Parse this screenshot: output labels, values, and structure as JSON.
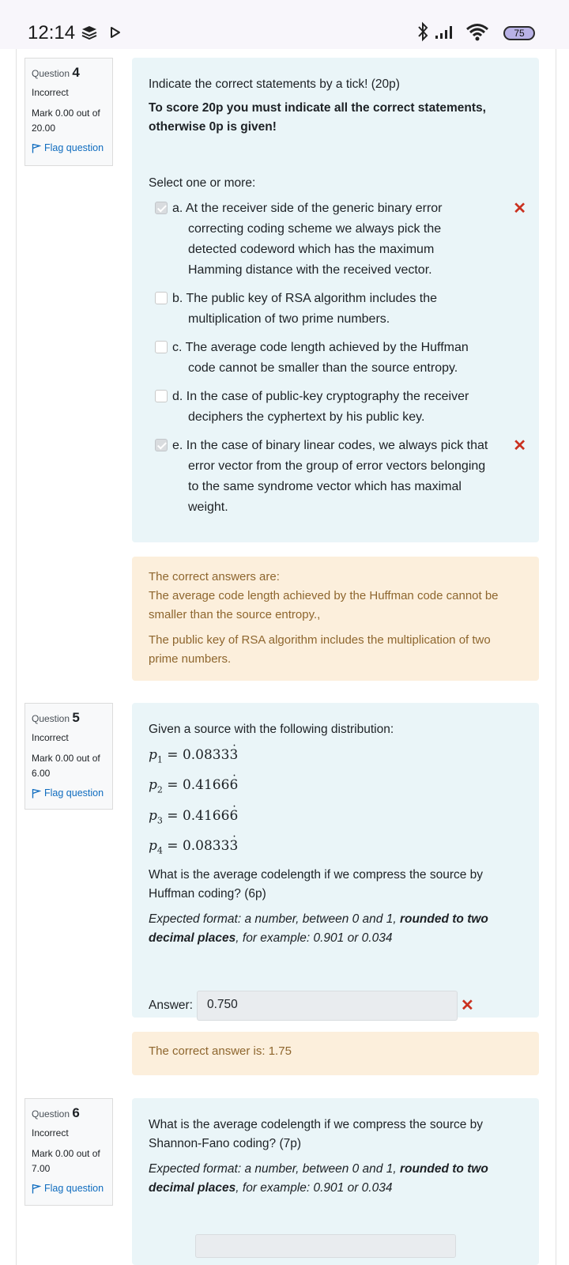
{
  "status_bar": {
    "time": "12:14",
    "battery": "75",
    "icons": [
      "layers-icon",
      "play-icon",
      "bluetooth-icon",
      "signal-icon",
      "wifi-icon",
      "battery-icon"
    ]
  },
  "colors": {
    "question_bg": "#eaf5f8",
    "feedback_bg": "#fcefdc",
    "feedback_text": "#8e662e",
    "link": "#0f6cbf",
    "incorrect": "#ca3120"
  },
  "questions": [
    {
      "info": {
        "label": "Question",
        "number": "4",
        "state": "Incorrect",
        "mark": "Mark 0.00 out of 20.00",
        "flag": "Flag question"
      },
      "text": "Indicate the correct statements by a tick! (20p)",
      "bold_text": "To score 20p you must indicate all the correct statements, otherwise 0p is given!",
      "prompt": "Select one or more:",
      "options": [
        {
          "text": "a. At the receiver side of the generic binary error correcting coding scheme we always pick the detected codeword which has the maximum Hamming distance with the received vector.",
          "checked": true,
          "incorrect": true
        },
        {
          "text": "b. The public key of RSA algorithm includes the multiplication of two prime numbers.",
          "checked": false,
          "incorrect": false
        },
        {
          "text": "c. The average code length achieved by the Huffman code cannot be smaller than the source entropy.",
          "checked": false,
          "incorrect": false
        },
        {
          "text": "d. In the case of public-key cryptography the receiver deciphers the cyphertext by his public key.",
          "checked": false,
          "incorrect": false
        },
        {
          "text": "e. In the case of binary linear codes, we always pick that error vector from the group of error vectors belonging to the same syndrome vector which has maximal weight.",
          "checked": true,
          "incorrect": true
        }
      ],
      "feedback": {
        "heading": "The correct answers are:",
        "answer1": "The average code length achieved by the Huffman code cannot be smaller than the source entropy.,",
        "answer2": "The public key of RSA algorithm includes the multiplication of two prime numbers."
      },
      "incorrect_mark": "✕"
    },
    {
      "info": {
        "label": "Question",
        "number": "5",
        "state": "Incorrect",
        "mark": "Mark 0.00 out of 6.00",
        "flag": "Flag question"
      },
      "text": "Given a source with the following distribution:",
      "distribution": [
        {
          "symbol": "p",
          "sub": "1",
          "value": "= 0.0833",
          "dot": "3"
        },
        {
          "symbol": "p",
          "sub": "2",
          "value": "= 0.4166",
          "dot": "6"
        },
        {
          "symbol": "p",
          "sub": "3",
          "value": "= 0.4166",
          "dot": "6"
        },
        {
          "symbol": "p",
          "sub": "4",
          "value": "= 0.0833",
          "dot": "3"
        }
      ],
      "question": "What is the average codelength if we compress the source by Huffman coding? (6p)",
      "format_intro": "Expected format: a number, between 0 and 1, ",
      "format_bold": "rounded to two decimal places",
      "format_outro": ", for example: 0.901 or 0.034",
      "answer_label": "Answer:",
      "answer_value": "0.750",
      "feedback": "The correct answer is: 1.75",
      "incorrect_mark": "✕"
    },
    {
      "info": {
        "label": "Question",
        "number": "6",
        "state": "Incorrect",
        "mark": "Mark 0.00 out of 7.00",
        "flag": "Flag question"
      },
      "question": "What is the average codelength if we compress the source by Shannon-Fano coding? (7p)",
      "format_intro": "Expected format: a number, between 0 and 1, ",
      "format_bold": "rounded to two decimal places",
      "format_outro": ", for example: 0.901 or 0.034"
    }
  ]
}
